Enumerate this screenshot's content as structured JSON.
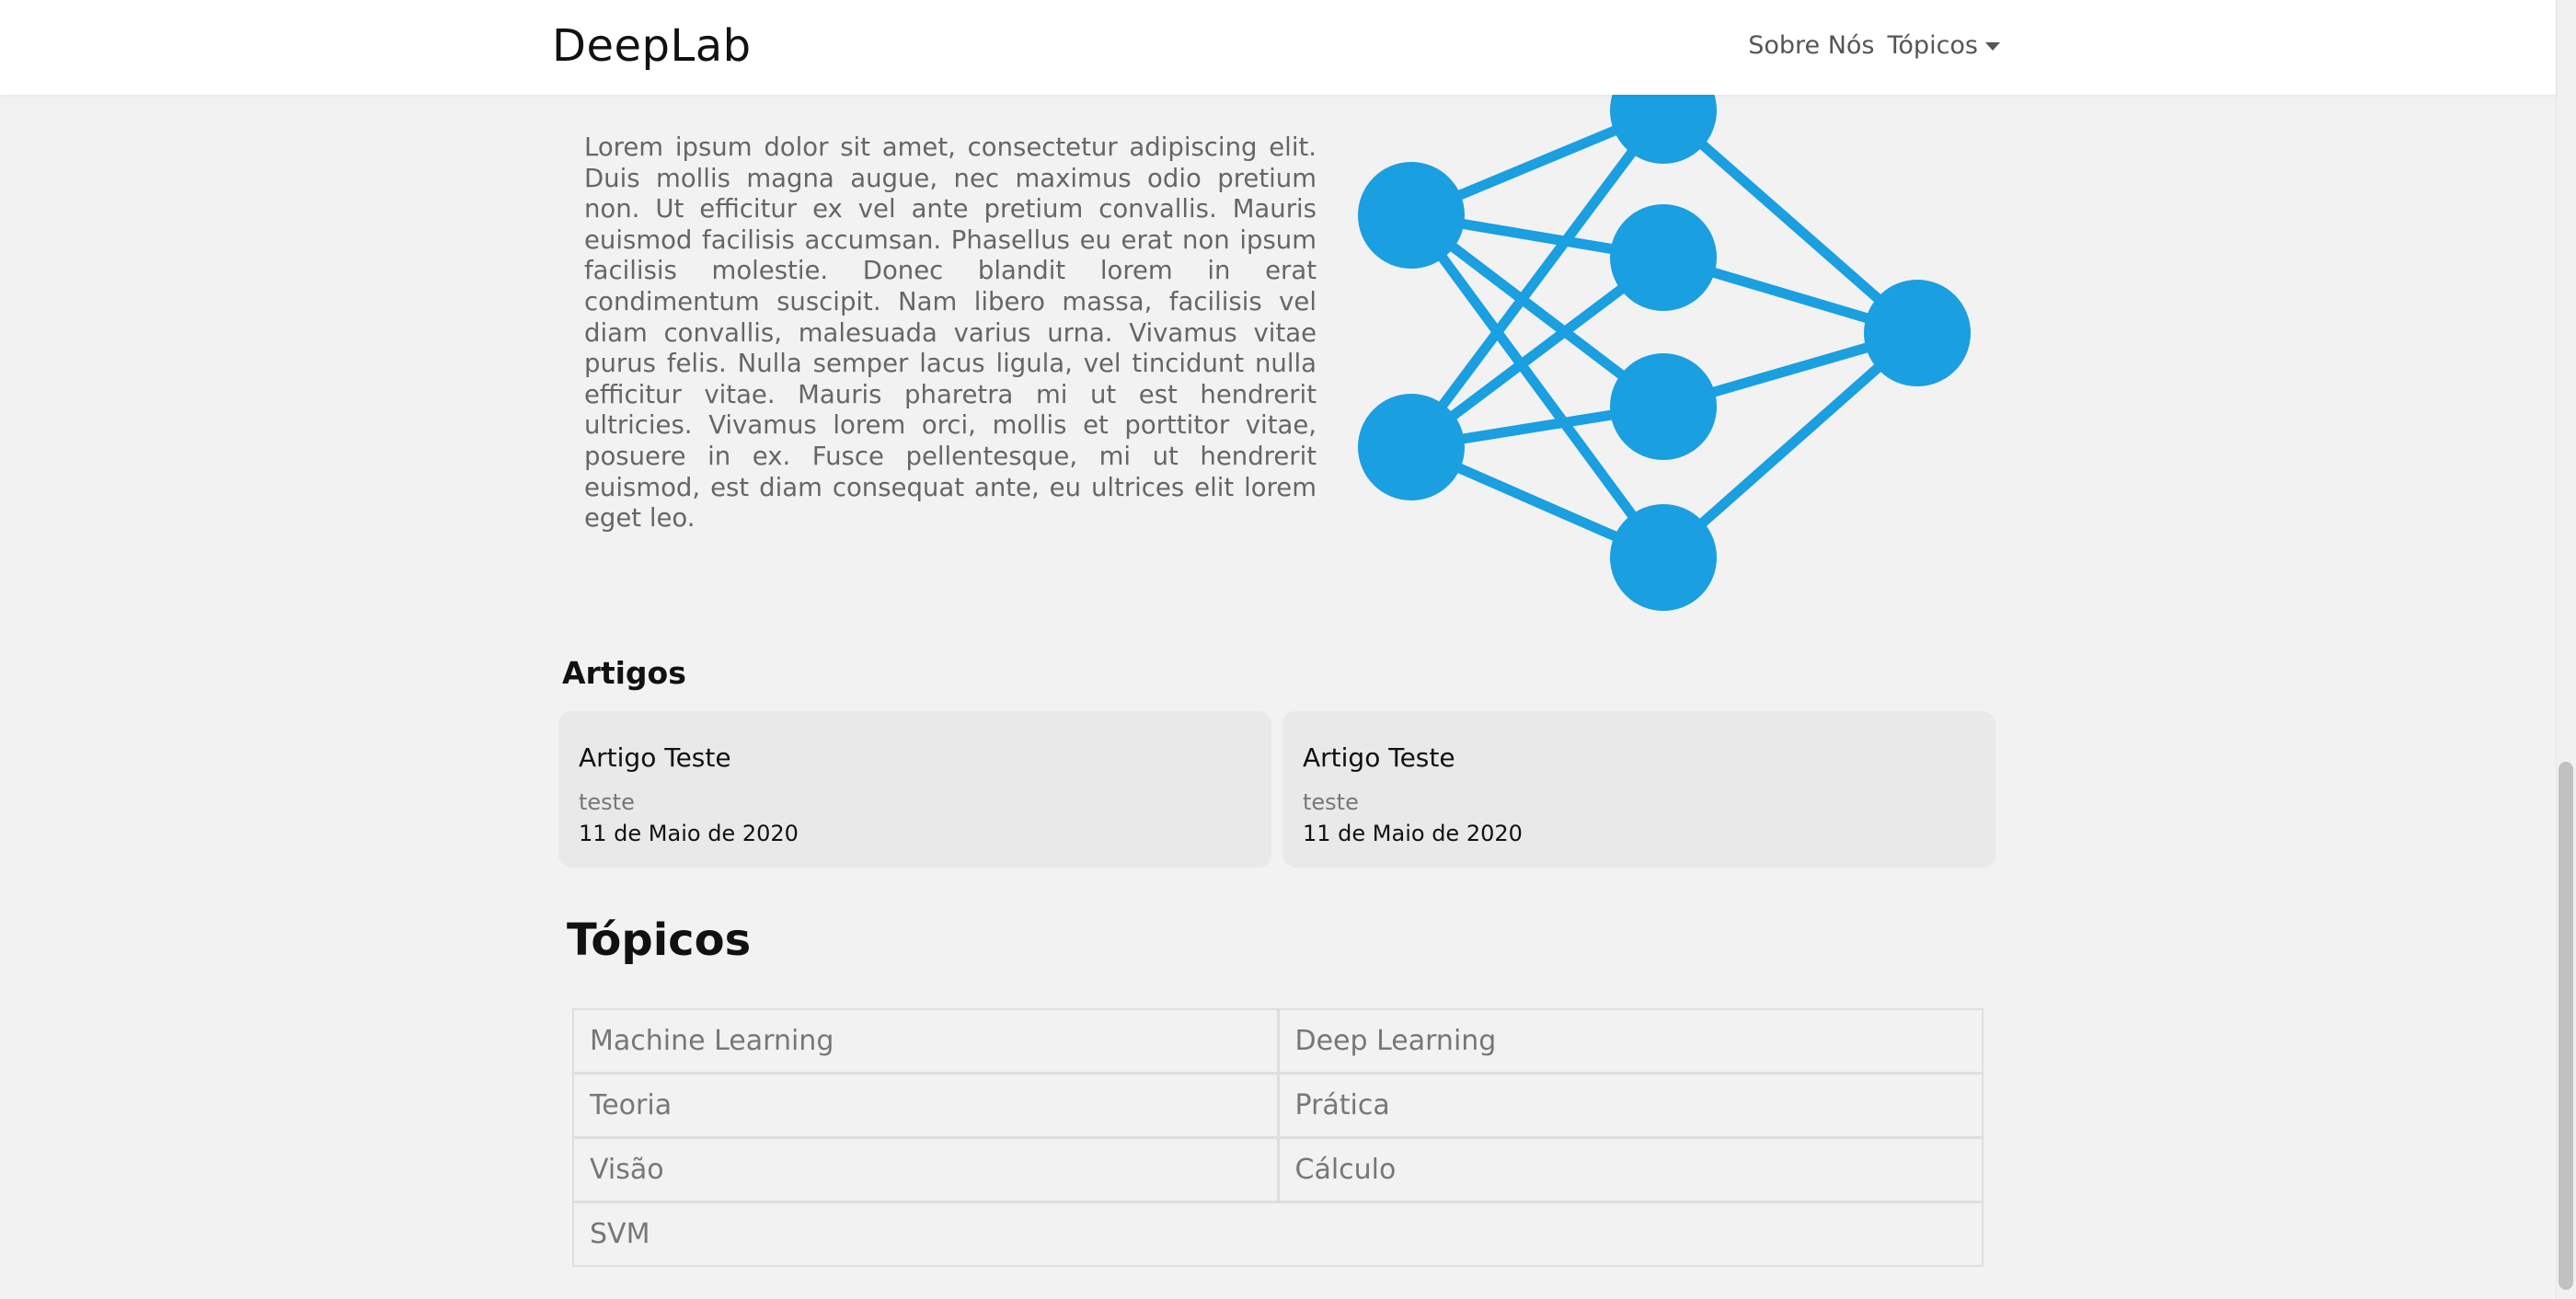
{
  "navbar": {
    "brand": "DeepLab",
    "links": {
      "about": "Sobre Nós",
      "topics": "Tópicos"
    }
  },
  "intro": {
    "text": "Lorem ipsum dolor sit amet, consectetur adipiscing elit. Duis mollis magna augue, nec maximus odio pretium non. Ut efficitur ex vel ante pretium convallis. Mauris euismod facilisis accumsan. Phasellus eu erat non ipsum facilisis molestie. Donec blandit lorem in erat condimentum suscipit. Nam libero massa, facilisis vel diam convallis, malesuada varius urna. Vivamus vitae purus felis. Nulla semper lacus ligula, vel tincidunt nulla efficitur vitae. Mauris pharetra mi ut est hendrerit ultricies. Vivamus lorem orci, mollis et porttitor vitae, posuere in ex. Fusce pellentesque, mi ut hendrerit euismod, est diam consequat ante, eu ultrices elit lorem eget leo."
  },
  "graphic": {
    "icon": "neural-network-icon",
    "color": "#1a9fe0"
  },
  "articles": {
    "heading": "Artigos",
    "items": [
      {
        "title": "Artigo Teste",
        "description": "teste",
        "date": "11 de Maio de 2020"
      },
      {
        "title": "Artigo Teste",
        "description": "teste",
        "date": "11 de Maio de 2020"
      }
    ]
  },
  "topics": {
    "heading": "Tópicos",
    "items": [
      "Machine Learning",
      "Deep Learning",
      "Teoria",
      "Prática",
      "Visão",
      "Cálculo",
      "SVM"
    ]
  },
  "colors": {
    "background": "#f2f2f2",
    "card": "#e9e9e9",
    "accent": "#1a9fe0"
  }
}
